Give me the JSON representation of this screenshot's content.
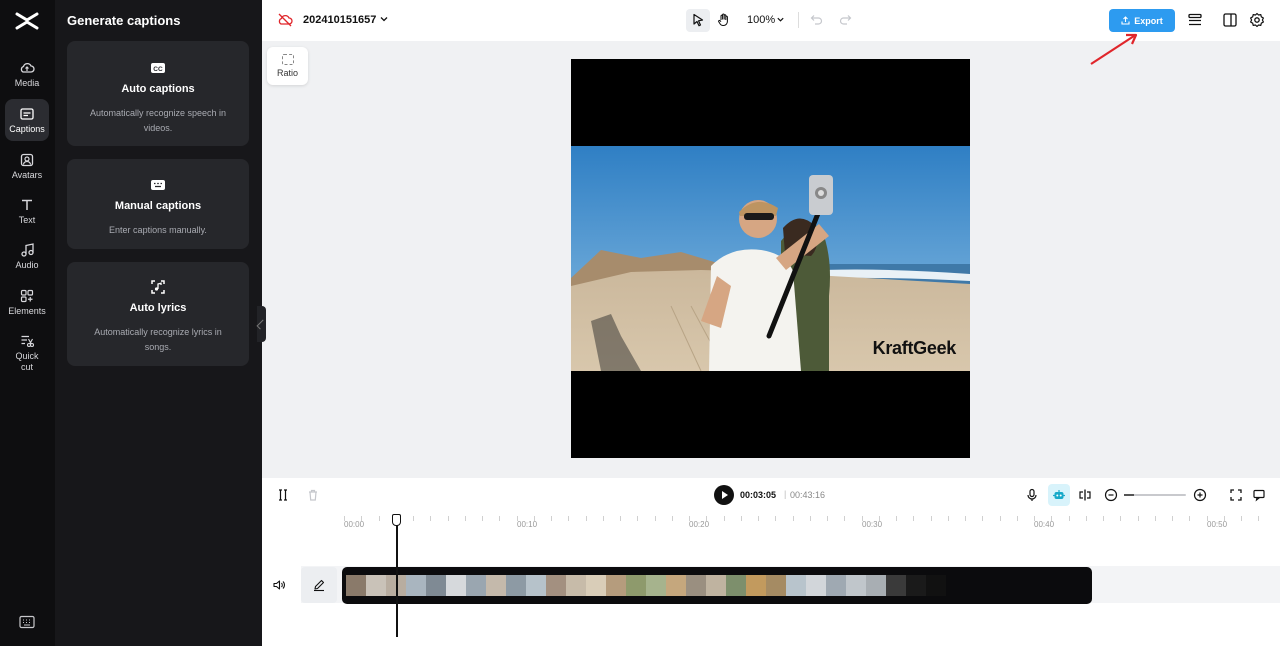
{
  "rail": {
    "items": [
      {
        "label": "Media",
        "icon": "media-cloud-icon"
      },
      {
        "label": "Captions",
        "icon": "captions-icon"
      },
      {
        "label": "Avatars",
        "icon": "avatar-icon"
      },
      {
        "label": "Text",
        "icon": "text-icon"
      },
      {
        "label": "Audio",
        "icon": "music-note-icon"
      },
      {
        "label": "Elements",
        "icon": "elements-grid-icon"
      },
      {
        "label": "Quick cut",
        "icon": "quick-cut-icon"
      }
    ],
    "active": "Captions"
  },
  "panel": {
    "title": "Generate captions",
    "cards": [
      {
        "title": "Auto captions",
        "desc": "Automatically recognize speech in videos.",
        "icon": "cc-icon"
      },
      {
        "title": "Manual captions",
        "desc": "Enter captions manually.",
        "icon": "keyboard-icon"
      },
      {
        "title": "Auto lyrics",
        "desc": "Automatically recognize lyrics in songs.",
        "icon": "lyrics-scan-icon"
      }
    ]
  },
  "topbar": {
    "project_name": "202410151657",
    "zoom": "100%",
    "export_label": "Export"
  },
  "preview": {
    "ratio_label": "Ratio",
    "watermark": "KraftGeek"
  },
  "controls": {
    "current_time": "00:03:05",
    "separator": "|",
    "total_time": "00:43:16"
  },
  "timeline": {
    "ruler": [
      "00:00",
      "00:10",
      "00:20",
      "00:30",
      "00:40",
      "00:50"
    ]
  },
  "colors": {
    "accent": "#2d9bf0",
    "rail_bg": "#0e0e10",
    "panel_bg": "#17171a",
    "card_bg": "#26272b",
    "annotation_arrow": "#e0262b"
  }
}
